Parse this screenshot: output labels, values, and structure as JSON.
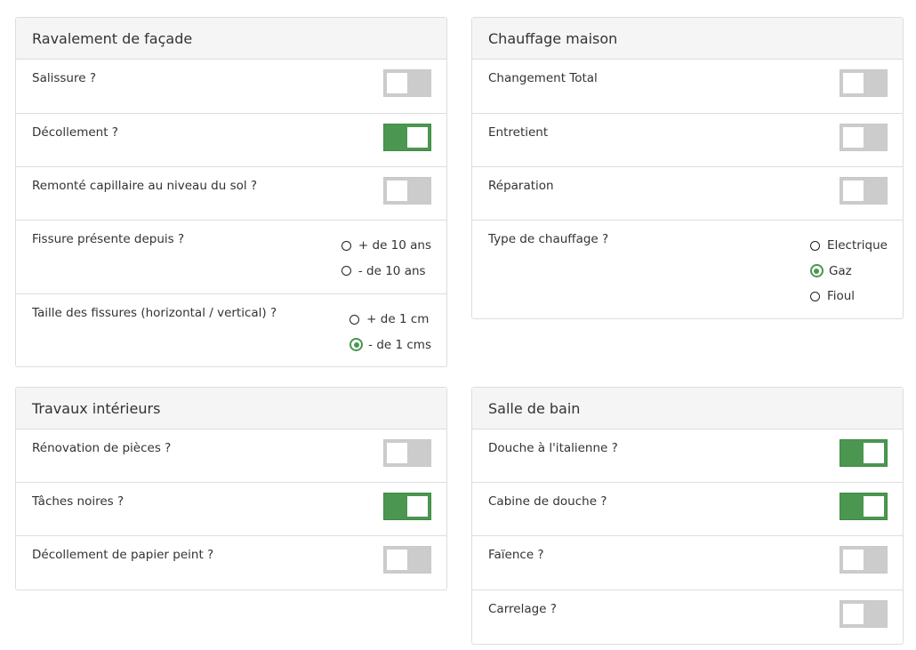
{
  "colors": {
    "toggle_on": "#4b9650",
    "toggle_off": "#cccccc",
    "border": "#dddddd",
    "header_bg": "#f5f5f5"
  },
  "ravalement": {
    "title": "Ravalement de façade",
    "salissure": {
      "label": "Salissure ?",
      "on": false
    },
    "decollement": {
      "label": "Décollement ?",
      "on": true
    },
    "remonte": {
      "label": "Remonté capillaire au niveau du sol ?",
      "on": false
    },
    "fissure": {
      "label": "Fissure présente depuis ?",
      "options": [
        "+ de 10 ans",
        "- de 10 ans"
      ],
      "selected": null
    },
    "taille": {
      "label": "Taille des fissures (horizontal / vertical) ?",
      "options": [
        "+ de 1 cm",
        "- de 1 cms"
      ],
      "selected": "- de 1 cms"
    }
  },
  "chauffage": {
    "title": "Chauffage maison",
    "changement": {
      "label": "Changement Total",
      "on": false
    },
    "entretient": {
      "label": "Entretient",
      "on": false
    },
    "reparation": {
      "label": "Réparation",
      "on": false
    },
    "type": {
      "label": "Type de chauffage ?",
      "options": [
        "Electrique",
        "Gaz",
        "Fioul"
      ],
      "selected": "Gaz"
    }
  },
  "travaux": {
    "title": "Travaux intérieurs",
    "renovation": {
      "label": "Rénovation de pièces ?",
      "on": false
    },
    "taches": {
      "label": "Tâches noires ?",
      "on": true
    },
    "papier": {
      "label": "Décollement de papier peint ?",
      "on": false
    }
  },
  "salle_bain": {
    "title": "Salle de bain",
    "douche_italienne": {
      "label": "Douche à l'italienne ?",
      "on": true
    },
    "cabine": {
      "label": "Cabine de douche ?",
      "on": true
    },
    "faience": {
      "label": "Faïence ?",
      "on": false
    },
    "carrelage": {
      "label": "Carrelage ?",
      "on": false
    }
  }
}
